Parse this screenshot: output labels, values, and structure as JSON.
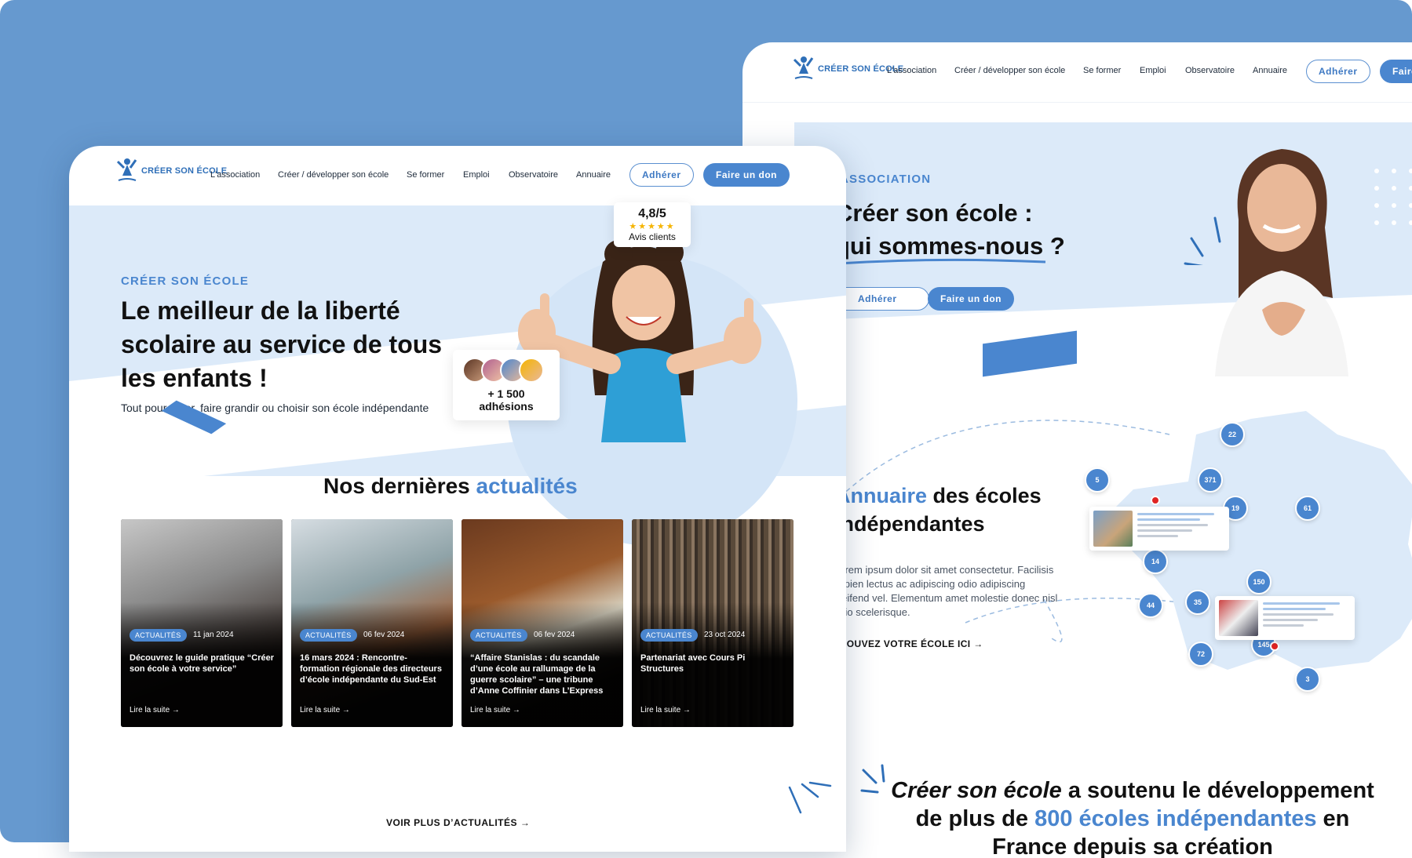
{
  "front": {
    "logo_text": "CRÉER SON ÉCOLE",
    "nav": [
      "L'association",
      "Créer / développer son école",
      "Se former",
      "Emploi",
      "Observatoire",
      "Annuaire"
    ],
    "btn_adherer": "Adhérer",
    "btn_don": "Faire un don",
    "hero": {
      "eyebrow": "CRÉER SON ÉCOLE",
      "title_line1": "Le meilleur de la liberté",
      "title_line2": "scolaire au service de tous",
      "title_line3": "les enfants !",
      "subtitle": "Tout pour créer, faire grandir ou choisir son école indépendante",
      "rating_value": "4,8/5",
      "rating_stars": "★★★★★",
      "rating_label": "Avis clients",
      "members_label": "+ 1 500 adhésions"
    },
    "news": {
      "title_prefix": "Nos dernières",
      "title_accent": "actualités",
      "cards": [
        {
          "badge": "ACTUALITÉS",
          "date": "11 jan 2024",
          "title": "Découvrez le guide pratique “Créer son école à votre service”",
          "more": "Lire la suite  →"
        },
        {
          "badge": "ACTUALITÉS",
          "date": "06 fev 2024",
          "title": "16 mars 2024 : Rencontre-formation régionale des directeurs d’école indépendante du Sud-Est",
          "more": "Lire la suite  →"
        },
        {
          "badge": "ACTUALITÉS",
          "date": "06 fev 2024",
          "title": "“Affaire Stanislas : du scandale d’une école au rallumage de la guerre scolaire” – une tribune d’Anne Coffinier dans L’Express",
          "more": "Lire la suite  →"
        },
        {
          "badge": "ACTUALITÉS",
          "date": "23 oct 2024",
          "title": "Partenariat avec Cours Pi Structures",
          "more": "Lire la suite  →"
        }
      ],
      "voir_plus": "VOIR PLUS D’ACTUALITÉS  →"
    }
  },
  "back": {
    "logo_text": "CRÉER SON ÉCOLE",
    "nav": [
      "L'association",
      "Créer / développer son école",
      "Se former",
      "Emploi",
      "Observatoire",
      "Annuaire"
    ],
    "btn_adherer": "Adhérer",
    "btn_don": "Faire",
    "hero": {
      "eyebrow": "ASSOCIATION",
      "title_line1": "Créer son école :",
      "title_line2": "qui sommes-nous ?",
      "btn_adherer": "Adhérer",
      "btn_don": "Faire un don"
    },
    "annuaire": {
      "title_accent": "Annuaire",
      "title_rest1": " des écoles",
      "title_line2": "indépendantes",
      "lorem1": "Lorem ipsum dolor sit amet consectetur. Facilisis",
      "lorem2": "sapien lectus ac adipiscing odio adipiscing",
      "lorem3": "eleifend vel. Elementum amet molestie donec nisl",
      "lorem4": "odio scelerisque.",
      "cta": "TROUVEZ VOTRE ÉCOLE ICI  →",
      "pins": [
        "22",
        "5",
        "371",
        "19",
        "61",
        "14",
        "150",
        "44",
        "35",
        "145",
        "72",
        "3"
      ]
    },
    "claim": {
      "italic": "Créer son école",
      "line1_rest": " a soutenu le développement",
      "line2_pre": "de plus de ",
      "line2_accent": "800 écoles indépendantes",
      "line2_post": " en",
      "line3": "France depuis sa création"
    }
  },
  "colors": {
    "background": "#6699cf",
    "accent": "#4a86cf",
    "hero_bg": "#dceaf9"
  }
}
